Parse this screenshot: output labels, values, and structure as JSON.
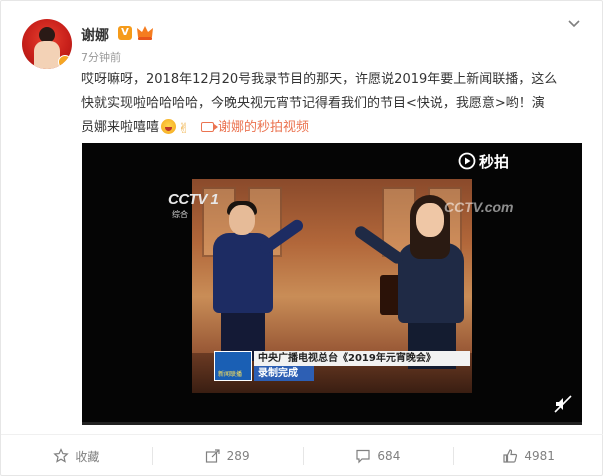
{
  "post": {
    "author": "谢娜",
    "verified_badge": "V",
    "time_ago": "7分钟前",
    "text_lines": [
      "哎呀嘛呀，2018年12月20号我录节目的那天，许愿说2019年要上新闻联播，这么",
      "快就实现啦哈哈哈哈，今晚央视元宵节记得看我们的节目<快说，我愿意>哟！演",
      "员娜来啦嘻嘻"
    ],
    "video_link": "谢娜的秒拍视频",
    "emojis": [
      "laugh-emoji",
      "victory-hand-emoji"
    ]
  },
  "video": {
    "watermark_brand": "秒拍",
    "channel_logo": "CCTV",
    "channel_number": "1",
    "channel_sub": "综合",
    "corner_watermark": "CCTV.com",
    "news_logo_text": "新闻联播",
    "caption_line1": "中央广播电视总台《2019年元宵晚会》",
    "caption_line2": "录制完成"
  },
  "actions": [
    {
      "label": "收藏",
      "icon": "star-icon"
    },
    {
      "label": "289",
      "icon": "share-icon"
    },
    {
      "label": "684",
      "icon": "comment-icon"
    },
    {
      "label": "4981",
      "icon": "like-icon"
    }
  ],
  "colors": {
    "link": "#eb7350",
    "text": "#333333",
    "muted": "#999999",
    "verified": "#f59b1a"
  }
}
